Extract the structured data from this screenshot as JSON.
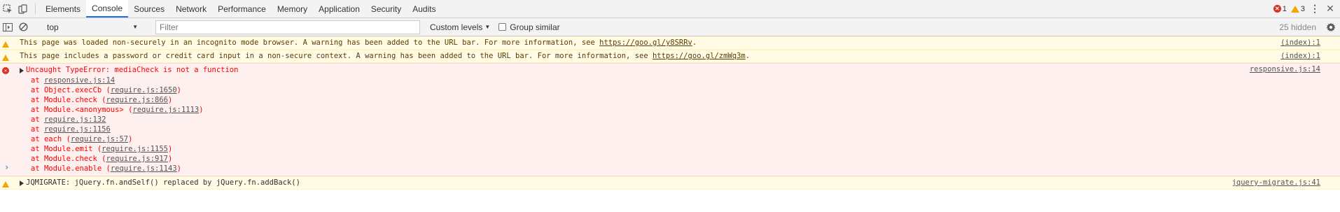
{
  "tabs": [
    "Elements",
    "Console",
    "Sources",
    "Network",
    "Performance",
    "Memory",
    "Application",
    "Security",
    "Audits"
  ],
  "active_tab": "Console",
  "counters": {
    "errors": "1",
    "warnings": "3"
  },
  "toolbar": {
    "context": "top",
    "filter_placeholder": "Filter",
    "levels_label": "Custom levels",
    "group_similar_label": "Group similar",
    "hidden_count": "25 hidden"
  },
  "messages": {
    "warn1": {
      "text": "This page was loaded non-securely in an incognito mode browser. A warning has been added to the URL bar. For more information, see ",
      "link": "https://goo.gl/y8SRRv",
      "suffix": ".",
      "source": "(index):1"
    },
    "warn2": {
      "text": "This page includes a password or credit card input in a non-secure context. A warning has been added to the URL bar. For more information, see ",
      "link": "https://goo.gl/zmWq3m",
      "suffix": ".",
      "source": "(index):1"
    },
    "error": {
      "text": "Uncaught TypeError: mediaCheck is not a function",
      "source": "responsive.js:14",
      "stack": [
        {
          "prefix": "at ",
          "fn": "",
          "loc": "responsive.js:14"
        },
        {
          "prefix": "at ",
          "fn": "Object.execCb ",
          "loc": "require.js:1650"
        },
        {
          "prefix": "at ",
          "fn": "Module.check ",
          "loc": "require.js:866"
        },
        {
          "prefix": "at ",
          "fn": "Module.<anonymous> ",
          "loc": "require.js:1113"
        },
        {
          "prefix": "at ",
          "fn": "",
          "loc": "require.js:132"
        },
        {
          "prefix": "at ",
          "fn": "",
          "loc": "require.js:1156"
        },
        {
          "prefix": "at ",
          "fn": "each ",
          "loc": "require.js:57"
        },
        {
          "prefix": "at ",
          "fn": "Module.emit ",
          "loc": "require.js:1155"
        },
        {
          "prefix": "at ",
          "fn": "Module.check ",
          "loc": "require.js:917"
        },
        {
          "prefix": "at ",
          "fn": "Module.enable ",
          "loc": "require.js:1143"
        }
      ]
    },
    "migrate": {
      "text": "JQMIGRATE: jQuery.fn.andSelf() replaced by jQuery.fn.addBack()",
      "source": "jquery-migrate.js:41"
    }
  },
  "prompt_symbol": "›",
  "icons": {
    "inspect": "inspect-element-icon",
    "device": "device-toolbar-icon",
    "sidebar": "console-sidebar-icon",
    "clear": "clear-console-icon",
    "settings": "gear-icon",
    "more": "kebab-menu-icon",
    "close": "close-icon"
  },
  "colors": {
    "error": "#ff0000",
    "warning_bg": "#fffbe5",
    "error_bg": "#fff0f0",
    "accent": "#1a73e8"
  }
}
